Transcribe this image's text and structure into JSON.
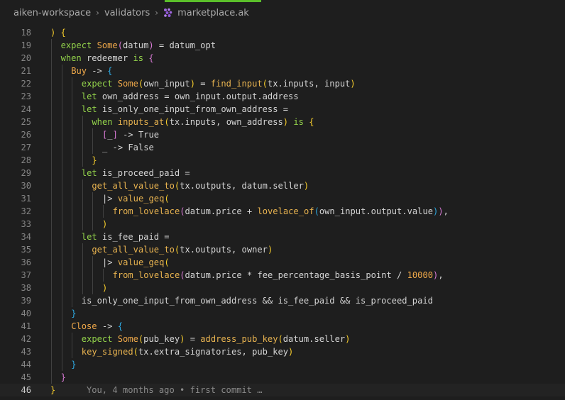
{
  "breadcrumb": {
    "items": [
      "aiken-workspace",
      "validators",
      "marketplace.ak"
    ],
    "file_icon": "aiken-file-icon",
    "accent_color": "#5bbf2a"
  },
  "colors": {
    "background": "#1e1e1e",
    "keyword": "#93d34b",
    "function": "#e8b350",
    "number": "#f0a94a",
    "bracket_level_1": "#f7cd2c",
    "bracket_level_2": "#d97bd6",
    "bracket_level_3": "#2ea8e0"
  },
  "editor": {
    "current_line": "46",
    "blame": "You, 4 months ago • first commit …",
    "lines": [
      {
        "n": "18",
        "tokens": [
          [
            "p1",
            ") {"
          ]
        ]
      },
      {
        "n": "19",
        "tokens": [
          [
            "kw",
            "expect "
          ],
          [
            "ctor",
            "Some"
          ],
          [
            "p2",
            "("
          ],
          [
            "d",
            "datum"
          ],
          [
            "p2",
            ")"
          ],
          [
            "d",
            " = datum_opt"
          ]
        ]
      },
      {
        "n": "20",
        "tokens": [
          [
            "kw",
            "when "
          ],
          [
            "d",
            "redeemer "
          ],
          [
            "kw",
            "is "
          ],
          [
            "p2",
            "{"
          ]
        ]
      },
      {
        "n": "21",
        "tokens": [
          [
            "ctor",
            "Buy"
          ],
          [
            "d",
            " -> "
          ],
          [
            "p3",
            "{"
          ]
        ]
      },
      {
        "n": "22",
        "tokens": [
          [
            "kw",
            "expect "
          ],
          [
            "ctor",
            "Some"
          ],
          [
            "p1",
            "("
          ],
          [
            "d",
            "own_input"
          ],
          [
            "p1",
            ")"
          ],
          [
            "d",
            " = "
          ],
          [
            "fn",
            "find_input"
          ],
          [
            "p1",
            "("
          ],
          [
            "d",
            "tx.inputs, input"
          ],
          [
            "p1",
            ")"
          ]
        ]
      },
      {
        "n": "23",
        "tokens": [
          [
            "kw",
            "let "
          ],
          [
            "d",
            "own_address = own_input.output.address"
          ]
        ]
      },
      {
        "n": "24",
        "tokens": [
          [
            "kw",
            "let "
          ],
          [
            "d",
            "is_only_one_input_from_own_address ="
          ]
        ]
      },
      {
        "n": "25",
        "tokens": [
          [
            "kw",
            "when "
          ],
          [
            "fn",
            "inputs_at"
          ],
          [
            "p1",
            "("
          ],
          [
            "d",
            "tx.inputs, own_address"
          ],
          [
            "p1",
            ")"
          ],
          [
            "d",
            " "
          ],
          [
            "kw",
            "is "
          ],
          [
            "p1",
            "{"
          ]
        ]
      },
      {
        "n": "26",
        "tokens": [
          [
            "p2",
            "["
          ],
          [
            "d",
            "_"
          ],
          [
            "p2",
            "]"
          ],
          [
            "d",
            " -> True"
          ]
        ]
      },
      {
        "n": "27",
        "tokens": [
          [
            "d",
            "_ -> False"
          ]
        ]
      },
      {
        "n": "28",
        "tokens": [
          [
            "p1",
            "}"
          ]
        ]
      },
      {
        "n": "29",
        "tokens": [
          [
            "kw",
            "let "
          ],
          [
            "d",
            "is_proceed_paid ="
          ]
        ]
      },
      {
        "n": "30",
        "tokens": [
          [
            "fn",
            "get_all_value_to"
          ],
          [
            "p1",
            "("
          ],
          [
            "d",
            "tx.outputs, datum.seller"
          ],
          [
            "p1",
            ")"
          ]
        ]
      },
      {
        "n": "31",
        "tokens": [
          [
            "d",
            "|> "
          ],
          [
            "fn",
            "value_geq"
          ],
          [
            "p1",
            "("
          ]
        ]
      },
      {
        "n": "32",
        "tokens": [
          [
            "fn",
            "from_lovelace"
          ],
          [
            "p2",
            "("
          ],
          [
            "d",
            "datum.price + "
          ],
          [
            "fn",
            "lovelace_of"
          ],
          [
            "p3",
            "("
          ],
          [
            "d",
            "own_input.output.value"
          ],
          [
            "p3",
            ")"
          ],
          [
            "p2",
            ")"
          ],
          [
            "d",
            ","
          ]
        ]
      },
      {
        "n": "33",
        "tokens": [
          [
            "p1",
            ")"
          ]
        ]
      },
      {
        "n": "34",
        "tokens": [
          [
            "kw",
            "let "
          ],
          [
            "d",
            "is_fee_paid ="
          ]
        ]
      },
      {
        "n": "35",
        "tokens": [
          [
            "fn",
            "get_all_value_to"
          ],
          [
            "p1",
            "("
          ],
          [
            "d",
            "tx.outputs, owner"
          ],
          [
            "p1",
            ")"
          ]
        ]
      },
      {
        "n": "36",
        "tokens": [
          [
            "d",
            "|> "
          ],
          [
            "fn",
            "value_geq"
          ],
          [
            "p1",
            "("
          ]
        ]
      },
      {
        "n": "37",
        "tokens": [
          [
            "fn",
            "from_lovelace"
          ],
          [
            "p2",
            "("
          ],
          [
            "d",
            "datum.price * fee_percentage_basis_point / "
          ],
          [
            "num",
            "10000"
          ],
          [
            "p2",
            ")"
          ],
          [
            "d",
            ","
          ]
        ]
      },
      {
        "n": "38",
        "tokens": [
          [
            "p1",
            ")"
          ]
        ]
      },
      {
        "n": "39",
        "tokens": [
          [
            "d",
            "is_only_one_input_from_own_address && is_fee_paid && is_proceed_paid"
          ]
        ]
      },
      {
        "n": "40",
        "tokens": [
          [
            "p3",
            "}"
          ]
        ]
      },
      {
        "n": "41",
        "tokens": [
          [
            "ctor",
            "Close"
          ],
          [
            "d",
            " -> "
          ],
          [
            "p3",
            "{"
          ]
        ]
      },
      {
        "n": "42",
        "tokens": [
          [
            "kw",
            "expect "
          ],
          [
            "ctor",
            "Some"
          ],
          [
            "p1",
            "("
          ],
          [
            "d",
            "pub_key"
          ],
          [
            "p1",
            ")"
          ],
          [
            "d",
            " = "
          ],
          [
            "fn",
            "address_pub_key"
          ],
          [
            "p1",
            "("
          ],
          [
            "d",
            "datum.seller"
          ],
          [
            "p1",
            ")"
          ]
        ]
      },
      {
        "n": "43",
        "tokens": [
          [
            "fn",
            "key_signed"
          ],
          [
            "p1",
            "("
          ],
          [
            "d",
            "tx.extra_signatories, pub_key"
          ],
          [
            "p1",
            ")"
          ]
        ]
      },
      {
        "n": "44",
        "tokens": [
          [
            "p3",
            "}"
          ]
        ]
      },
      {
        "n": "45",
        "tokens": [
          [
            "p2",
            "}"
          ]
        ]
      },
      {
        "n": "46",
        "tokens": [
          [
            "p1",
            "}"
          ]
        ]
      }
    ]
  }
}
